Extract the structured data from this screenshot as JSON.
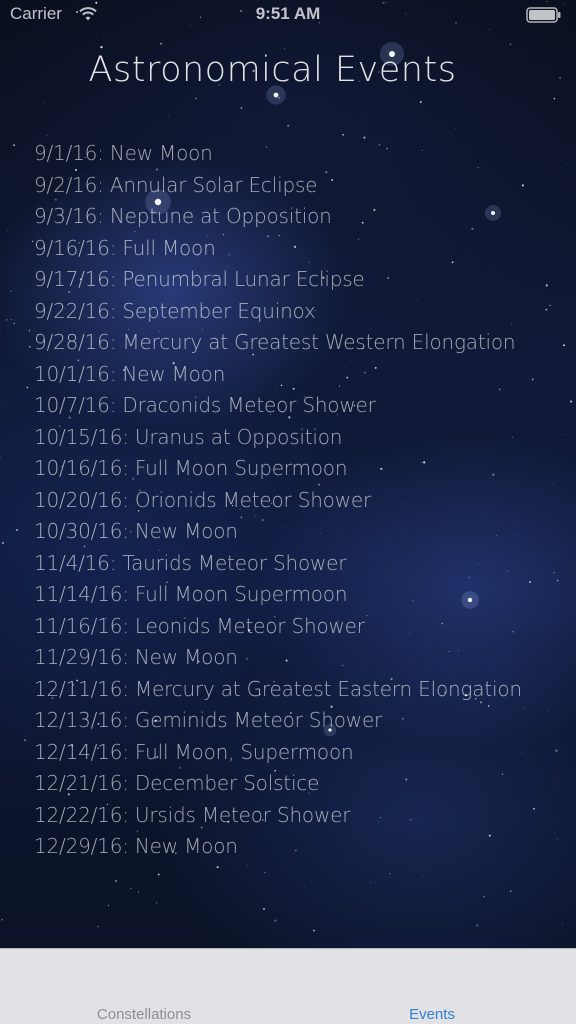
{
  "status_bar": {
    "carrier": "Carrier",
    "time": "9:51 AM",
    "icons": [
      "wifi-icon",
      "battery-icon"
    ]
  },
  "header": {
    "title": "Astronomical Events"
  },
  "events": [
    "9/1/16: New Moon",
    "9/2/16: Annular Solar Eclipse",
    "9/3/16: Neptune at Opposition",
    "9/16/16: Full Moon",
    "9/17/16: Penumbral Lunar Eclipse",
    "9/22/16: September Equinox",
    "9/28/16: Mercury at Greatest Western Elongation",
    "10/1/16: New Moon",
    "10/7/16: Draconids Meteor Shower",
    "10/15/16: Uranus at Opposition",
    "10/16/16: Full Moon Supermoon",
    "10/20/16: Orionids Meteor Shower",
    "10/30/16: New Moon",
    "11/4/16: Taurids Meteor Shower",
    "11/14/16: Full Moon Supermoon",
    "11/16/16: Leonids Meteor Shower",
    "11/29/16: New Moon",
    "12/11/16: Mercury at Greatest Eastern Elongation",
    "12/13/16: Geminids Meteor Shower",
    "12/14/16: Full Moon, Supermoon",
    "12/21/16: December Solstice",
    "12/22/16: Ursids Meteor Shower",
    "12/29/16: New Moon"
  ],
  "tab_bar": {
    "tabs": [
      {
        "label": "Constellations",
        "selected": false
      },
      {
        "label": "Events",
        "selected": true
      }
    ],
    "active_color": "#2f7fd6",
    "inactive_color": "#8e8e93"
  }
}
